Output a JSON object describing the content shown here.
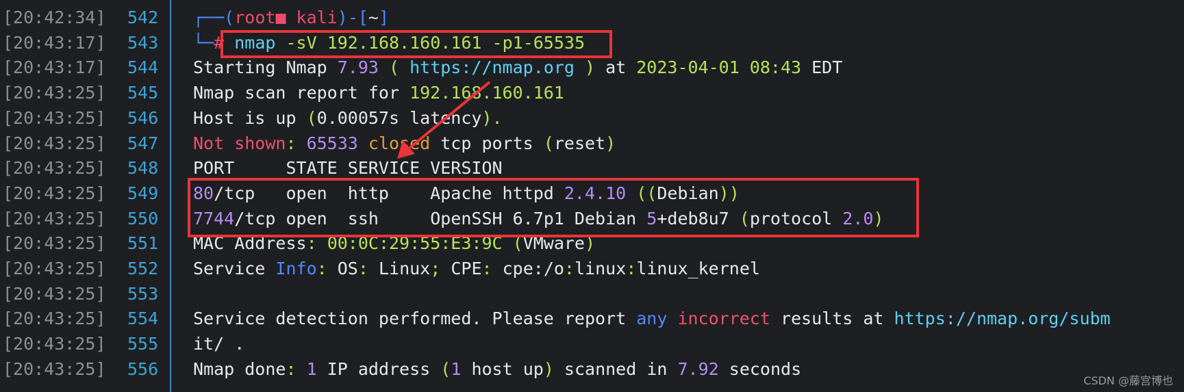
{
  "gutter": [
    {
      "time": "[20:42:34]",
      "line": "542"
    },
    {
      "time": "[20:43:17]",
      "line": "543"
    },
    {
      "time": "[20:43:17]",
      "line": "544"
    },
    {
      "time": "[20:43:25]",
      "line": "545"
    },
    {
      "time": "[20:43:25]",
      "line": "546"
    },
    {
      "time": "[20:43:25]",
      "line": "547"
    },
    {
      "time": "[20:43:25]",
      "line": "548"
    },
    {
      "time": "[20:43:25]",
      "line": "549"
    },
    {
      "time": "[20:43:25]",
      "line": "550"
    },
    {
      "time": "[20:43:25]",
      "line": "551"
    },
    {
      "time": "[20:43:25]",
      "line": "552"
    },
    {
      "time": "[20:43:25]",
      "line": "553"
    },
    {
      "time": "[20:43:25]",
      "line": "554"
    },
    {
      "time": "[20:43:25]",
      "line": "555"
    },
    {
      "time": "[20:43:25]",
      "line": "556"
    }
  ],
  "terminal": {
    "lines": [
      [
        {
          "t": "┌──(",
          "c": "blue"
        },
        {
          "t": "root",
          "c": "pink"
        },
        {
          "t": "■",
          "c": "pink"
        },
        {
          "t": " kali",
          "c": "pink"
        },
        {
          "t": ")-[",
          "c": "blue"
        },
        {
          "t": "~",
          "c": "white"
        },
        {
          "t": "]",
          "c": "blue"
        }
      ],
      [
        {
          "t": "└─",
          "c": "blue"
        },
        {
          "t": "# ",
          "c": "pink"
        },
        {
          "t": "nmap",
          "c": "cyan"
        },
        {
          "t": " -sV ",
          "c": "green"
        },
        {
          "t": "192.168.160.161",
          "c": "green"
        },
        {
          "t": " -p1-65535",
          "c": "green"
        }
      ],
      [
        {
          "t": "Starting Nmap ",
          "c": "white"
        },
        {
          "t": "7.93",
          "c": "purple"
        },
        {
          "t": " ( ",
          "c": "green"
        },
        {
          "t": "https://nmap.org",
          "c": "cyan"
        },
        {
          "t": " ) ",
          "c": "green"
        },
        {
          "t": "at ",
          "c": "white"
        },
        {
          "t": "2023-04-01 08:43",
          "c": "green"
        },
        {
          "t": " EDT",
          "c": "white"
        }
      ],
      [
        {
          "t": "Nmap scan report for ",
          "c": "white"
        },
        {
          "t": "192.168.160.161",
          "c": "green"
        }
      ],
      [
        {
          "t": "Host is up ",
          "c": "white"
        },
        {
          "t": "(",
          "c": "green"
        },
        {
          "t": "0.00057s latency",
          "c": "white"
        },
        {
          "t": ").",
          "c": "green"
        }
      ],
      [
        {
          "t": "Not shown",
          "c": "red"
        },
        {
          "t": ": ",
          "c": "green"
        },
        {
          "t": "65533",
          "c": "purple"
        },
        {
          "t": " closed",
          "c": "orange"
        },
        {
          "t": " tcp ports ",
          "c": "white"
        },
        {
          "t": "(",
          "c": "green"
        },
        {
          "t": "reset",
          "c": "white"
        },
        {
          "t": ")",
          "c": "green"
        }
      ],
      [
        {
          "t": "PORT     STATE SERVICE VERSION",
          "c": "white"
        }
      ],
      [
        {
          "t": "80",
          "c": "purple"
        },
        {
          "t": "/tcp   open  http    Apache httpd ",
          "c": "white"
        },
        {
          "t": "2.4.10",
          "c": "purple"
        },
        {
          "t": " ((",
          "c": "green"
        },
        {
          "t": "Debian",
          "c": "white"
        },
        {
          "t": "))",
          "c": "green"
        }
      ],
      [
        {
          "t": "7744",
          "c": "purple"
        },
        {
          "t": "/tcp open  ssh     OpenSSH 6.7p1 Debian ",
          "c": "white"
        },
        {
          "t": "5",
          "c": "purple"
        },
        {
          "t": "+deb8u7 ",
          "c": "white"
        },
        {
          "t": "(",
          "c": "green"
        },
        {
          "t": "protocol ",
          "c": "white"
        },
        {
          "t": "2.0",
          "c": "purple"
        },
        {
          "t": ")",
          "c": "green"
        }
      ],
      [
        {
          "t": "MAC Address",
          "c": "white"
        },
        {
          "t": ": ",
          "c": "green"
        },
        {
          "t": "00:0C:29:55:E3:9C",
          "c": "green"
        },
        {
          "t": " (",
          "c": "green"
        },
        {
          "t": "VMware",
          "c": "white"
        },
        {
          "t": ")",
          "c": "green"
        }
      ],
      [
        {
          "t": "Service ",
          "c": "white"
        },
        {
          "t": "Info",
          "c": "blue"
        },
        {
          "t": ": ",
          "c": "green"
        },
        {
          "t": "OS",
          "c": "white"
        },
        {
          "t": ": ",
          "c": "green"
        },
        {
          "t": "Linux",
          "c": "white"
        },
        {
          "t": "; ",
          "c": "green"
        },
        {
          "t": "CPE",
          "c": "white"
        },
        {
          "t": ": ",
          "c": "green"
        },
        {
          "t": "cpe:/o",
          "c": "white"
        },
        {
          "t": ":",
          "c": "green"
        },
        {
          "t": "linux",
          "c": "white"
        },
        {
          "t": ":",
          "c": "green"
        },
        {
          "t": "linux_kernel",
          "c": "white"
        }
      ],
      [
        {
          "t": "",
          "c": "white"
        }
      ],
      [
        {
          "t": "Service detection performed. Please report ",
          "c": "white"
        },
        {
          "t": "any",
          "c": "blue"
        },
        {
          "t": " ",
          "c": "white"
        },
        {
          "t": "incorrect",
          "c": "red"
        },
        {
          "t": " results at ",
          "c": "white"
        },
        {
          "t": "https://nmap.org/subm",
          "c": "cyan"
        }
      ],
      [
        {
          "t": "it/ .",
          "c": "white"
        }
      ],
      [
        {
          "t": "Nmap done",
          "c": "white"
        },
        {
          "t": ": ",
          "c": "green"
        },
        {
          "t": "1",
          "c": "purple"
        },
        {
          "t": " IP address ",
          "c": "white"
        },
        {
          "t": "(",
          "c": "green"
        },
        {
          "t": "1",
          "c": "purple"
        },
        {
          "t": " host up",
          "c": "white"
        },
        {
          "t": ")",
          "c": "green"
        },
        {
          "t": " scanned in ",
          "c": "white"
        },
        {
          "t": "7.92",
          "c": "purple"
        },
        {
          "t": " seconds",
          "c": "white"
        }
      ]
    ]
  },
  "watermark": "CSDN @藤宫博也",
  "colors": {
    "background": "#1e1f22",
    "highlight_box": "#e8343a",
    "arrow": "#e8343a"
  }
}
